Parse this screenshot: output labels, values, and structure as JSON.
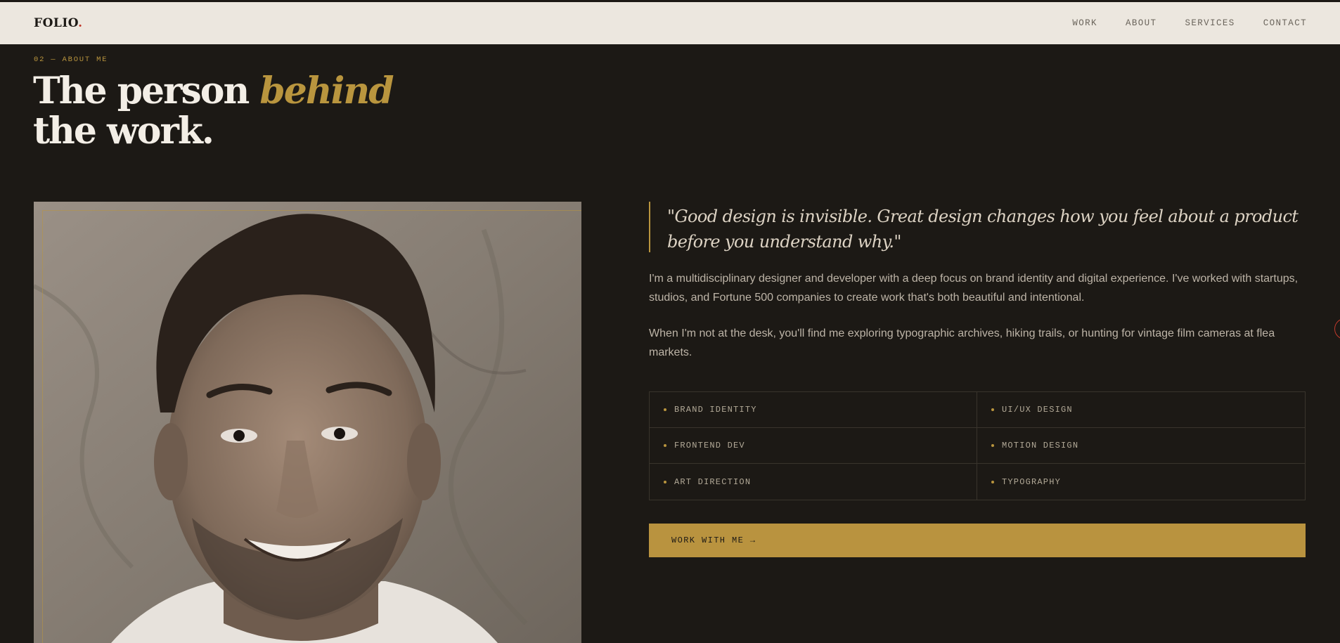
{
  "nav": {
    "logo": "FOLIO",
    "logo_dot": ".",
    "links": [
      "WORK",
      "ABOUT",
      "SERVICES",
      "CONTACT"
    ]
  },
  "about": {
    "eyebrow": "02 — ABOUT ME",
    "headline_line1": "The person ",
    "headline_accent": "behind",
    "headline_line2": "the work.",
    "quote": "\"Good design is invisible. Great design changes how you feel about a product before you understand why.\"",
    "paragraph1": "I'm a multidisciplinary designer and developer with a deep focus on brand identity and digital experience. I've worked with startups, studios, and Fortune 500 companies to create work that's both beautiful and intentional.",
    "paragraph2": "When I'm not at the desk, you'll find me exploring typographic archives, hiking trails, or hunting for vintage film cameras at flea markets.",
    "skills": [
      "BRAND IDENTITY",
      "UI/UX DESIGN",
      "FRONTEND DEV",
      "MOTION DESIGN",
      "ART DIRECTION",
      "TYPOGRAPHY"
    ],
    "cta": "WORK WITH ME →"
  },
  "colors": {
    "background": "#1c1915",
    "nav_background": "#ece7df",
    "accent": "#b9953e",
    "logo_dot": "#c0392b"
  },
  "icons": [
    "bullet-dot"
  ]
}
